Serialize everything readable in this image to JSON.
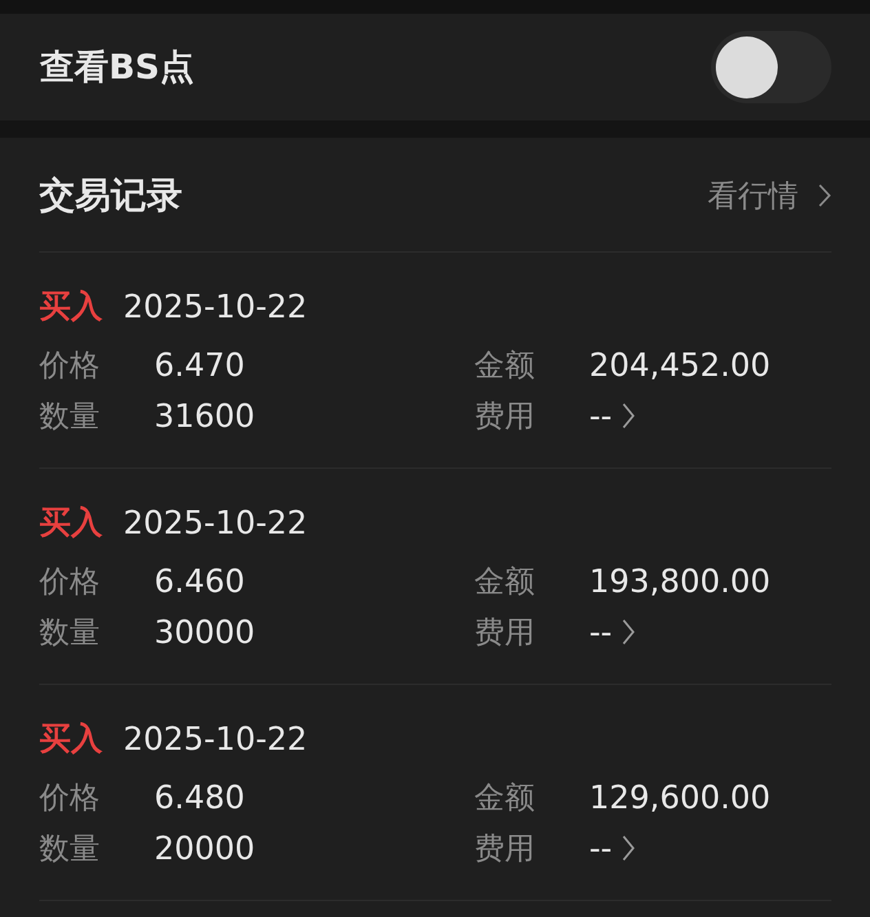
{
  "bs_toggle": {
    "label": "查看BS点",
    "on": false
  },
  "records": {
    "title": "交易记录",
    "link": "看行情",
    "trades": [
      {
        "side": "买入",
        "kind": "buy",
        "date": "2025-10-22",
        "fields": [
          {
            "label": "价格",
            "value": "6.470"
          },
          {
            "label": "金额",
            "value": "204,452.00"
          },
          {
            "label": "数量",
            "value": "31600"
          },
          {
            "label": "费用",
            "value": "--",
            "kind": "link"
          }
        ]
      },
      {
        "side": "买入",
        "kind": "buy",
        "date": "2025-10-22",
        "fields": [
          {
            "label": "价格",
            "value": "6.460"
          },
          {
            "label": "金额",
            "value": "193,800.00"
          },
          {
            "label": "数量",
            "value": "30000"
          },
          {
            "label": "费用",
            "value": "--",
            "kind": "link"
          }
        ]
      },
      {
        "side": "买入",
        "kind": "buy",
        "date": "2025-10-22",
        "fields": [
          {
            "label": "价格",
            "value": "6.480"
          },
          {
            "label": "金额",
            "value": "129,600.00"
          },
          {
            "label": "数量",
            "value": "20000"
          },
          {
            "label": "费用",
            "value": "--",
            "kind": "link"
          }
        ]
      }
    ]
  }
}
